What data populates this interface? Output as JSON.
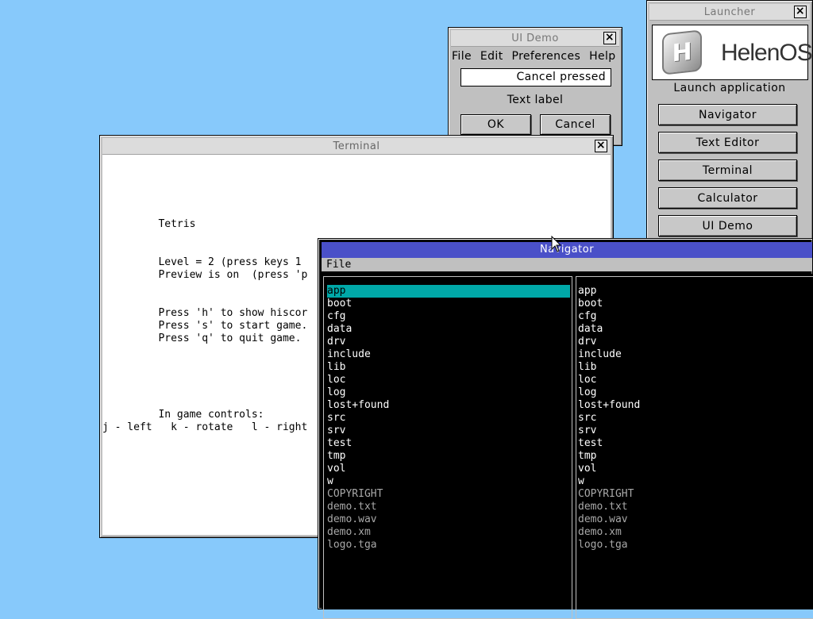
{
  "launcher": {
    "title": "Launcher",
    "logo_text": "HelenOS",
    "logo_mark": "H",
    "launch_label": "Launch application",
    "buttons": [
      "Navigator",
      "Text Editor",
      "Terminal",
      "Calculator",
      "UI Demo"
    ]
  },
  "uidemo": {
    "title": "UI Demo",
    "menu": [
      "File",
      "Edit",
      "Preferences",
      "Help"
    ],
    "text_field": "Cancel pressed",
    "text_label": "Text label",
    "ok_label": "OK",
    "cancel_label": "Cancel"
  },
  "terminal": {
    "title": "Terminal",
    "lines": [
      "         Tetris",
      "         Level = 2 (press keys 1",
      "         Preview is on  (press 'p",
      "         Press 'h' to show hiscor",
      "         Press 's' to start game.",
      "         Press 'q' to quit game.",
      "         In game controls:",
      "j - left   k - rotate   l - right"
    ]
  },
  "navigator": {
    "title": "Navigator",
    "menu_file": "File",
    "left_panel": {
      "selected_index": 0,
      "entries": [
        "app",
        "boot",
        "cfg",
        "data",
        "drv",
        "include",
        "lib",
        "loc",
        "log",
        "lost+found",
        "src",
        "srv",
        "test",
        "tmp",
        "vol",
        "w",
        "COPYRIGHT",
        "demo.txt",
        "demo.wav",
        "demo.xm",
        "logo.tga"
      ]
    },
    "right_panel": {
      "entries": [
        "app",
        "boot",
        "cfg",
        "data",
        "drv",
        "include",
        "lib",
        "loc",
        "log",
        "lost+found",
        "src",
        "srv",
        "test",
        "tmp",
        "vol",
        "w",
        "COPYRIGHT",
        "demo.txt",
        "demo.wav",
        "demo.xm",
        "logo.tga"
      ]
    },
    "directory_count": 16
  },
  "colors": {
    "desktop": "#87c9fb",
    "navigator_title": "#4a50c8",
    "selection": "#00a8a8"
  }
}
